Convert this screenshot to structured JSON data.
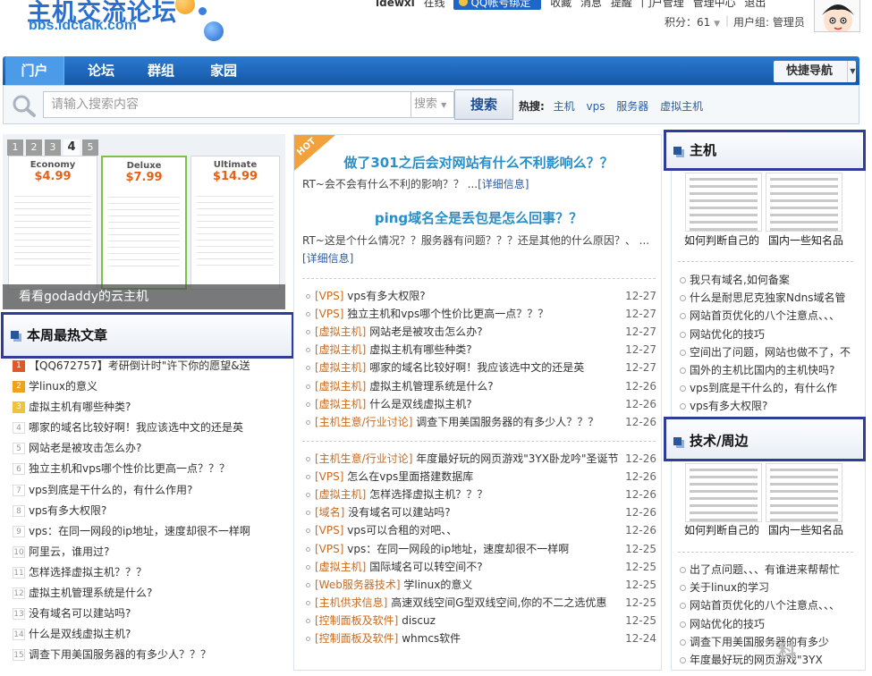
{
  "header": {
    "logo_title": "主机交流论坛",
    "logo_url": "bbs.idctalk.com",
    "topbar": {
      "username": "idewxl",
      "online_status": "在线",
      "qq_button": "QQ帐号绑定",
      "links": [
        "收藏",
        "消息",
        "提醒",
        "门户管理",
        "管理中心",
        "退出"
      ]
    },
    "credit": "积分：61",
    "usergroup": "用户组: 管理员"
  },
  "nav": {
    "items": [
      "门户",
      "论坛",
      "群组",
      "家园"
    ],
    "quick_nav": "快捷导航"
  },
  "search": {
    "placeholder": "请输入搜索内容",
    "type": "搜索",
    "button": "搜索",
    "hot_label": "热搜:",
    "hot_terms": [
      "主机",
      "vps",
      "服务器",
      "虚拟主机"
    ]
  },
  "slider": {
    "numbers": [
      "1",
      "2",
      "3",
      "4",
      "5"
    ],
    "caption": "看看godaddy的云主机",
    "plans": [
      {
        "name": "Economy",
        "price": "$4.99"
      },
      {
        "name": "Deluxe",
        "price": "$7.99"
      },
      {
        "name": "Ultimate",
        "price": "$14.99"
      }
    ]
  },
  "weekly": {
    "title": "本周最热文章",
    "items": [
      {
        "n": "1",
        "text": "【QQ672757】考研倒计时\"许下你的愿望&送"
      },
      {
        "n": "2",
        "text": "学linux的意义"
      },
      {
        "n": "3",
        "text": "虚拟主机有哪些种类?"
      },
      {
        "n": "4",
        "text": "哪家的域名比较好啊！我应该选中文的还是英"
      },
      {
        "n": "5",
        "text": "网站老是被攻击怎么办?"
      },
      {
        "n": "6",
        "text": "独立主机和vps哪个性价比更高一点？？？"
      },
      {
        "n": "7",
        "text": "vps到底是干什么的，有什么作用?"
      },
      {
        "n": "8",
        "text": "vps有多大权限?"
      },
      {
        "n": "9",
        "text": "vps：在同一网段的ip地址，速度却很不一样啊"
      },
      {
        "n": "10",
        "text": "阿里云，谁用过?"
      },
      {
        "n": "11",
        "text": "怎样选择虚拟主机？？？"
      },
      {
        "n": "12",
        "text": "虚拟主机管理系统是什么?"
      },
      {
        "n": "13",
        "text": "没有域名可以建站吗?"
      },
      {
        "n": "14",
        "text": "什么是双线虚拟主机?"
      },
      {
        "n": "15",
        "text": "调查下用美国服务器的有多少人？？？"
      }
    ]
  },
  "featured": {
    "badge": "HOT",
    "articles": [
      {
        "title": "做了301之后会对网站有什么不利影响么？？",
        "summary": "RT~会不会有什么不利的影响？？ ...",
        "more": "[详细信息]"
      },
      {
        "title": "ping域名全是丢包是怎么回事？？",
        "summary": "RT~这是个什么情况？？服务器有问题？？？还是其他的什么原因？、 ...",
        "more": "[详细信息]"
      }
    ]
  },
  "list1": [
    {
      "cat": "[VPS]",
      "title": "vps有多大权限?",
      "date": "12-27"
    },
    {
      "cat": "[VPS]",
      "title": "独立主机和vps哪个性价比更高一点？？？",
      "date": "12-27"
    },
    {
      "cat": "[虚拟主机]",
      "title": "网站老是被攻击怎么办?",
      "date": "12-27"
    },
    {
      "cat": "[虚拟主机]",
      "title": "虚拟主机有哪些种类?",
      "date": "12-27"
    },
    {
      "cat": "[虚拟主机]",
      "title": "哪家的域名比较好啊！我应该选中文的还是英",
      "date": "12-27"
    },
    {
      "cat": "[虚拟主机]",
      "title": "虚拟主机管理系统是什么?",
      "date": "12-26"
    },
    {
      "cat": "[虚拟主机]",
      "title": "什么是双线虚拟主机?",
      "date": "12-26"
    },
    {
      "cat": "[主机生意/行业讨论]",
      "title": "调查下用美国服务器的有多少人？？？",
      "date": "12-26"
    }
  ],
  "list2": [
    {
      "cat": "[主机生意/行业讨论]",
      "title": "年度最好玩的网页游戏\"3YX卧龙吟\"圣诞节",
      "date": "12-26"
    },
    {
      "cat": "[VPS]",
      "title": "怎么在vps里面搭建数据库",
      "date": "12-26"
    },
    {
      "cat": "[虚拟主机]",
      "title": "怎样选择虚拟主机？？？",
      "date": "12-26"
    },
    {
      "cat": "[域名]",
      "title": "没有域名可以建站吗?",
      "date": "12-26"
    },
    {
      "cat": "[VPS]",
      "title": "vps可以合租的对吧、、",
      "date": "12-26"
    },
    {
      "cat": "[VPS]",
      "title": "vps：在同一网段的ip地址，速度却很不一样啊",
      "date": "12-25"
    },
    {
      "cat": "[虚拟主机]",
      "title": "国际域名可以转空间不?",
      "date": "12-25"
    },
    {
      "cat": "[Web服务器技术]",
      "title": "学linux的意义",
      "date": "12-25"
    },
    {
      "cat": "[主机供求信息]",
      "title": "高速双线空间G型双线空间,你的不二之选优惠",
      "date": "12-25"
    },
    {
      "cat": "[控制面板及软件]",
      "title": "discuz",
      "date": "12-25"
    },
    {
      "cat": "[控制面板及软件]",
      "title": "whmcs软件",
      "date": "12-24"
    }
  ],
  "right": {
    "box1": {
      "title": "主机",
      "thumbs": [
        "如何判断自己的",
        "国内一些知名品"
      ],
      "links": [
        "我只有域名,如何备案",
        "什么是耐思尼克独家Ndns域名管",
        "网站首页优化的八个注意点、、、",
        "网站优化的技巧",
        "空间出了问题，网站也做不了，不",
        "国外的主机比国内的主机快吗?",
        "vps到底是干什么的，有什么作",
        "vps有多大权限?"
      ]
    },
    "box2": {
      "title": "技术/周边",
      "thumbs": [
        "如何判断自己的",
        "国内一些知名品"
      ],
      "links": [
        "出了点问题、、、有谁进来帮帮忙",
        "关于linux的学习",
        "网站首页优化的八个注意点、、、",
        "网站优化的技巧",
        "调查下用美国服务器的有多少",
        "年度最好玩的网页游戏\"3YX"
      ]
    }
  },
  "watermark": "科",
  "colors": {
    "nav": "#1f6bbd",
    "accent_orange": "#c96a1f",
    "link_blue": "#2b5ba8",
    "box_border": "#2f3c9a"
  }
}
